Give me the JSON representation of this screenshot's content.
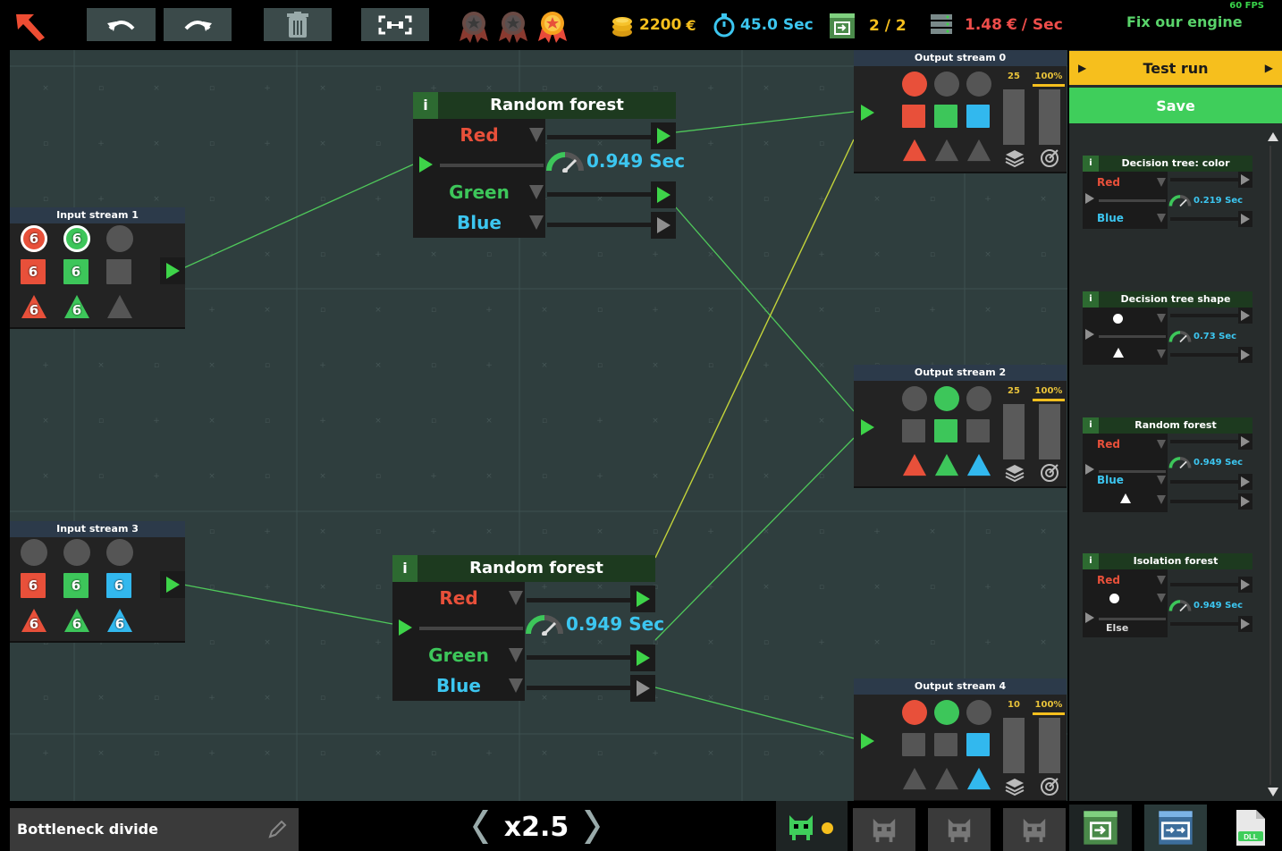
{
  "topbar": {
    "coins": "2200",
    "time": "45.0 Sec",
    "progress": "2 / 2",
    "rate": "1.48",
    "rate_unit": "/ Sec",
    "goal": "Fix our engine",
    "fps": "60 FPS",
    "medals": [
      "bronze-medal",
      "silver-medal",
      "gold-medal"
    ],
    "medals_earned": 1
  },
  "canvas": {
    "input_streams": [
      {
        "title": "Input stream 1",
        "cells": [
          {
            "shape": "circle",
            "color": "#e8503a",
            "count": "6"
          },
          {
            "shape": "circle",
            "color": "#3dc65a",
            "count": "6"
          },
          {
            "shape": "circle",
            "color": "#555555",
            "count": ""
          },
          {
            "shape": "square",
            "color": "#e8503a",
            "count": "6"
          },
          {
            "shape": "square",
            "color": "#3dc65a",
            "count": "6"
          },
          {
            "shape": "square",
            "color": "#555555",
            "count": ""
          },
          {
            "shape": "triangle",
            "color": "#e8503a",
            "count": "6"
          },
          {
            "shape": "triangle",
            "color": "#3dc65a",
            "count": "6"
          },
          {
            "shape": "triangle",
            "color": "#555555",
            "count": ""
          }
        ]
      },
      {
        "title": "Input stream 3",
        "cells": [
          {
            "shape": "circle",
            "color": "#555555",
            "count": ""
          },
          {
            "shape": "circle",
            "color": "#555555",
            "count": ""
          },
          {
            "shape": "circle",
            "color": "#555555",
            "count": ""
          },
          {
            "shape": "square",
            "color": "#e8503a",
            "count": "6"
          },
          {
            "shape": "square",
            "color": "#3dc65a",
            "count": "6"
          },
          {
            "shape": "square",
            "color": "#32b8ee",
            "count": "6"
          },
          {
            "shape": "triangle",
            "color": "#e8503a",
            "count": "6"
          },
          {
            "shape": "triangle",
            "color": "#3dc65a",
            "count": "6"
          },
          {
            "shape": "triangle",
            "color": "#32b8ee",
            "count": "6"
          }
        ]
      }
    ],
    "nodes": [
      {
        "title": "Random forest",
        "info": "i",
        "red": "Red",
        "green": "Green",
        "blue": "Blue",
        "speed": "0.949 Sec"
      },
      {
        "title": "Random forest",
        "info": "i",
        "red": "Red",
        "green": "Green",
        "blue": "Blue",
        "speed": "0.949 Sec"
      }
    ],
    "output_streams": [
      {
        "title": "Output stream 0",
        "count": "25",
        "percent": "100%",
        "count_level": 1.0,
        "percent_level": 1.0,
        "cells": [
          {
            "shape": "circle",
            "color": "#e8503a"
          },
          {
            "shape": "circle",
            "color": "#555555"
          },
          {
            "shape": "circle",
            "color": "#555555"
          },
          {
            "shape": "square",
            "color": "#e8503a"
          },
          {
            "shape": "square",
            "color": "#3dc65a"
          },
          {
            "shape": "square",
            "color": "#32b8ee"
          },
          {
            "shape": "triangle",
            "color": "#e8503a"
          },
          {
            "shape": "triangle",
            "color": "#555555"
          },
          {
            "shape": "triangle",
            "color": "#555555"
          }
        ]
      },
      {
        "title": "Output stream 2",
        "count": "25",
        "percent": "100%",
        "count_level": 1.0,
        "percent_level": 1.0,
        "cells": [
          {
            "shape": "circle",
            "color": "#555555"
          },
          {
            "shape": "circle",
            "color": "#3dc65a"
          },
          {
            "shape": "circle",
            "color": "#555555"
          },
          {
            "shape": "square",
            "color": "#555555"
          },
          {
            "shape": "square",
            "color": "#3dc65a"
          },
          {
            "shape": "square",
            "color": "#555555"
          },
          {
            "shape": "triangle",
            "color": "#e8503a"
          },
          {
            "shape": "triangle",
            "color": "#3dc65a"
          },
          {
            "shape": "triangle",
            "color": "#32b8ee"
          }
        ]
      },
      {
        "title": "Output stream 4",
        "count": "10",
        "percent": "100%",
        "count_level": 1.0,
        "percent_level": 1.0,
        "cells": [
          {
            "shape": "circle",
            "color": "#e8503a"
          },
          {
            "shape": "circle",
            "color": "#3dc65a"
          },
          {
            "shape": "circle",
            "color": "#555555"
          },
          {
            "shape": "square",
            "color": "#555555"
          },
          {
            "shape": "square",
            "color": "#555555"
          },
          {
            "shape": "square",
            "color": "#32b8ee"
          },
          {
            "shape": "triangle",
            "color": "#555555"
          },
          {
            "shape": "triangle",
            "color": "#555555"
          },
          {
            "shape": "triangle",
            "color": "#32b8ee"
          }
        ]
      }
    ]
  },
  "sidebar": {
    "test_run": "Test run",
    "save": "Save",
    "cards": [
      {
        "title": "Decision tree: color",
        "info": "i",
        "row1": "Red",
        "row2": "Blue",
        "speed": "0.219 Sec"
      },
      {
        "title": "Decision tree shape",
        "info": "i",
        "row1": "",
        "row2": "",
        "speed": "0.73 Sec"
      },
      {
        "title": "Random forest",
        "info": "i",
        "row1": "Red",
        "row2": "Blue",
        "speed": "0.949 Sec"
      },
      {
        "title": "Isolation forest",
        "info": "i",
        "row1": "Red",
        "row2": "Else",
        "speed": "0.949 Sec"
      }
    ]
  },
  "bottombar": {
    "level_name": "Bottleneck divide",
    "speed": "x2.5"
  },
  "colors": {
    "red": "#e8503a",
    "green": "#3dc65a",
    "blue": "#32b8ee",
    "accent_yellow": "#f6bf1d",
    "accent_green": "#3fce5b",
    "wire_green": "#4fc85a",
    "wire_yellow": "#c4d43a"
  }
}
